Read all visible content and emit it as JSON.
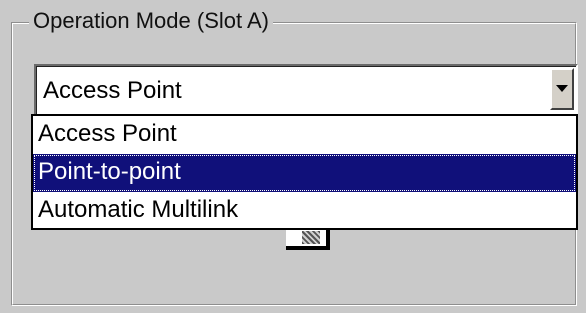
{
  "group": {
    "title": "Operation Mode (Slot A)"
  },
  "combo": {
    "selected_value": "Access Point",
    "arrow_icon": "chevron-down-icon"
  },
  "dropdown": {
    "options": [
      {
        "label": "Access Point",
        "highlighted": false
      },
      {
        "label": "Point-to-point",
        "highlighted": true
      },
      {
        "label": "Automatic Multilink",
        "highlighted": false
      }
    ]
  },
  "colors": {
    "background": "#c9c9c9",
    "highlight": "#10107a",
    "highlight_text": "#ffffff",
    "list_background": "#ffffff"
  }
}
